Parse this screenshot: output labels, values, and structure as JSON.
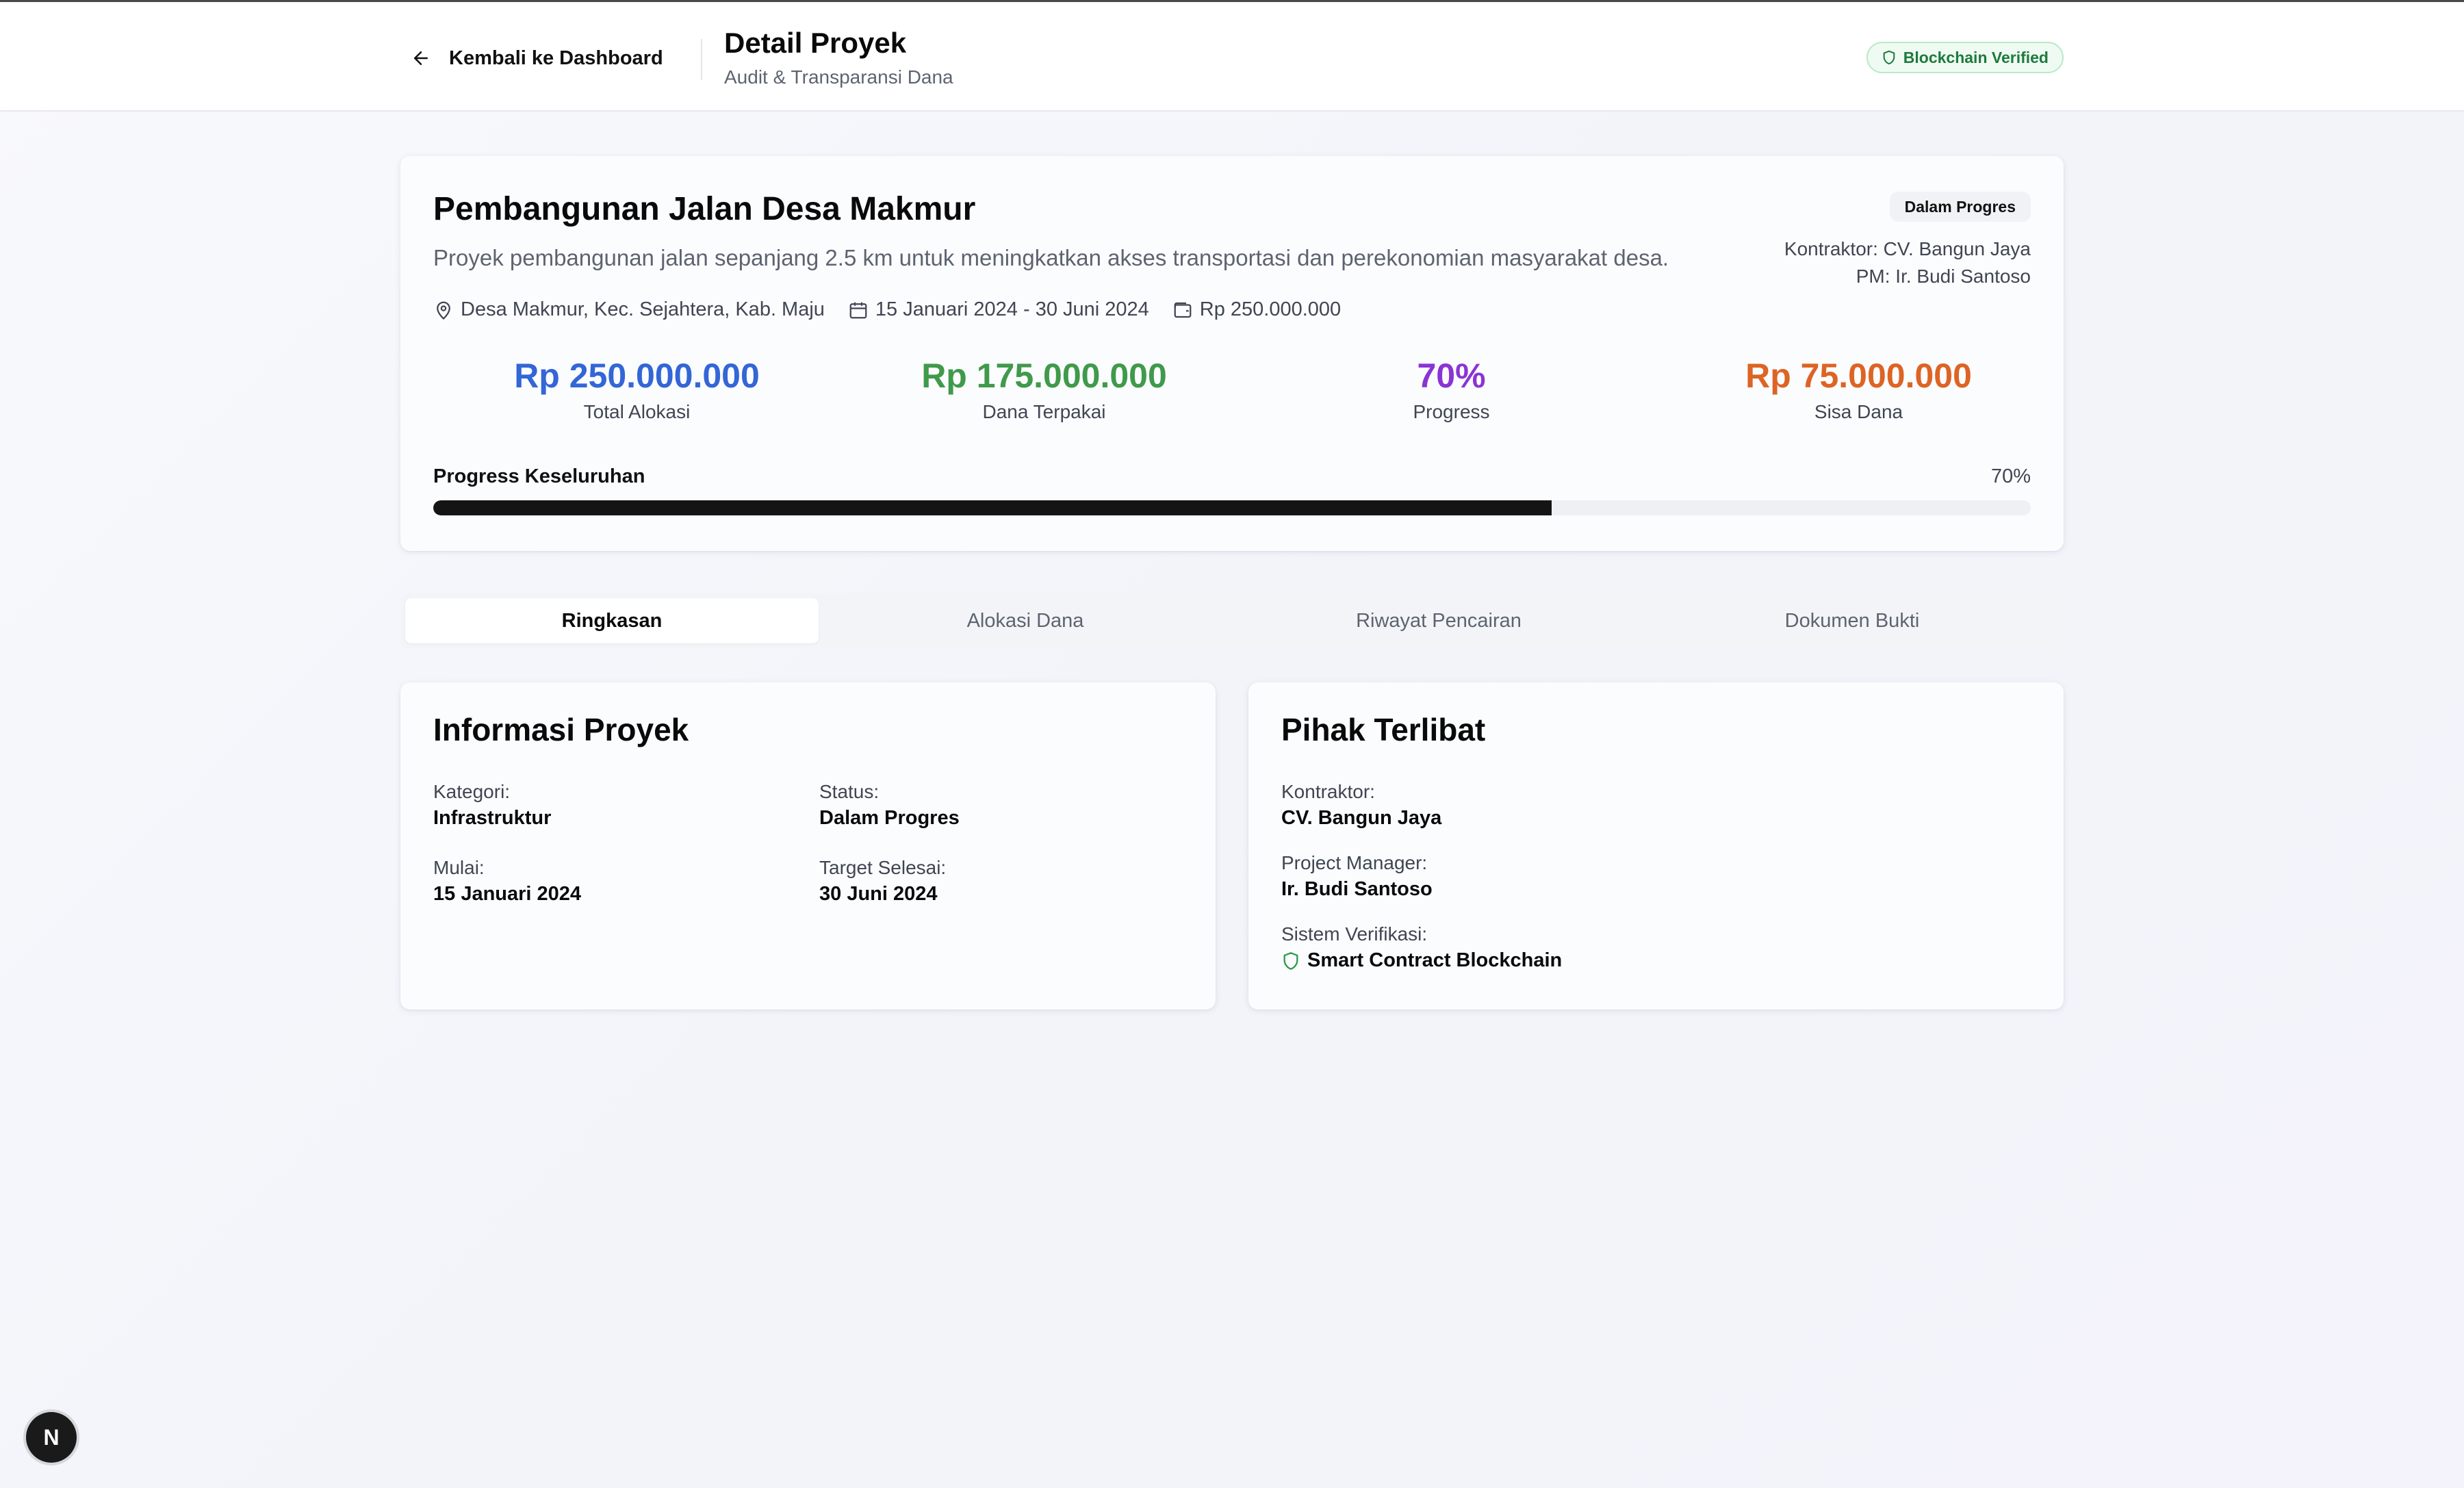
{
  "header": {
    "back_label": "Kembali ke Dashboard",
    "title": "Detail Proyek",
    "subtitle": "Audit & Transparansi Dana",
    "verified_badge": "Blockchain Verified"
  },
  "project": {
    "title": "Pembangunan Jalan Desa Makmur",
    "description": "Proyek pembangunan jalan sepanjang 2.5 km untuk meningkatkan akses transportasi dan perekonomian masyarakat desa.",
    "status": "Dalam Progres",
    "contractor_line": "Kontraktor: CV. Bangun Jaya",
    "pm_line": "PM: Ir. Budi Santoso",
    "location": "Desa Makmur, Kec. Sejahtera, Kab. Maju",
    "dates": "15 Januari 2024 - 30 Juni 2024",
    "budget": "Rp 250.000.000",
    "stats": [
      {
        "value": "Rp 250.000.000",
        "label": "Total Alokasi",
        "color": "#3366d6"
      },
      {
        "value": "Rp 175.000.000",
        "label": "Dana Terpakai",
        "color": "#3f9a4b"
      },
      {
        "value": "70%",
        "label": "Progress",
        "color": "#8a34d4"
      },
      {
        "value": "Rp 75.000.000",
        "label": "Sisa Dana",
        "color": "#dd6424"
      }
    ],
    "progress_label": "Progress Keseluruhan",
    "progress_text": "70%",
    "progress_value": 0.7
  },
  "tabs": [
    {
      "label": "Ringkasan",
      "active": true
    },
    {
      "label": "Alokasi Dana",
      "active": false
    },
    {
      "label": "Riwayat Pencairan",
      "active": false
    },
    {
      "label": "Dokumen Bukti",
      "active": false
    }
  ],
  "info": {
    "title": "Informasi Proyek",
    "kategori_label": "Kategori:",
    "kategori": "Infrastruktur",
    "status_label": "Status:",
    "status": "Dalam Progres",
    "mulai_label": "Mulai:",
    "mulai": "15 Januari 2024",
    "target_label": "Target Selesai:",
    "target": "30 Juni 2024"
  },
  "parties": {
    "title": "Pihak Terlibat",
    "kontraktor_label": "Kontraktor:",
    "kontraktor": "CV. Bangun Jaya",
    "pm_label": "Project Manager:",
    "pm": "Ir. Budi Santoso",
    "verif_label": "Sistem Verifikasi:",
    "verif": "Smart Contract Blockchain"
  },
  "dev_badge": "N",
  "icons": {
    "back": "arrow-left-icon",
    "verified": "shield-icon",
    "location": "map-pin-icon",
    "calendar": "calendar-icon",
    "wallet": "wallet-icon"
  }
}
